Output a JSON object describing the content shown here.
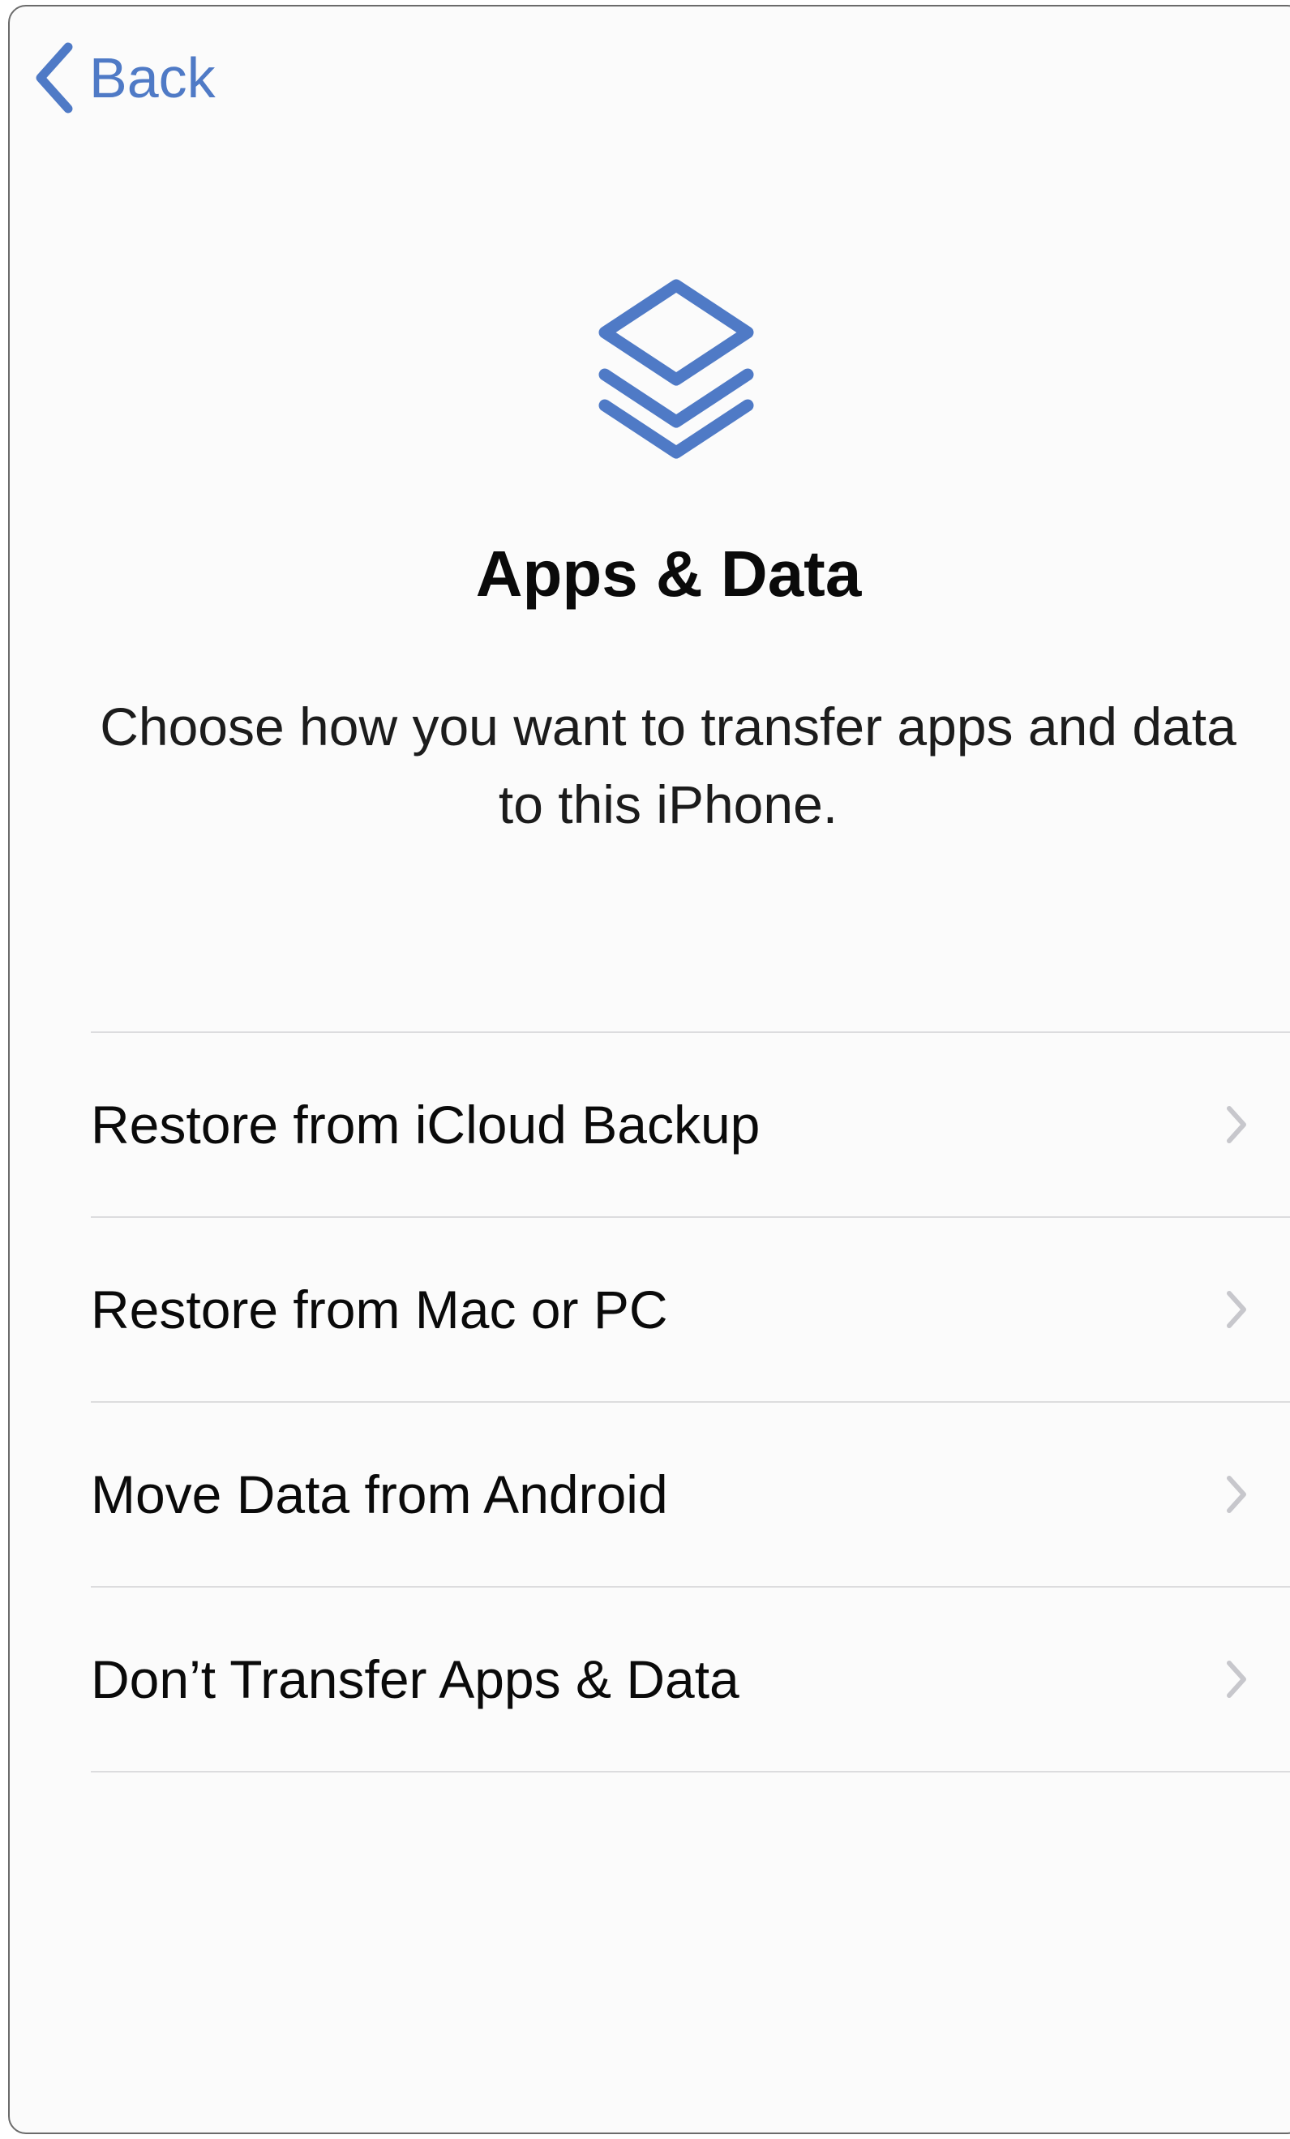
{
  "nav": {
    "back_label": "Back",
    "back_icon": "chevron-left-icon"
  },
  "hero": {
    "icon": "stacked-layers-icon",
    "title": "Apps & Data",
    "subtitle": "Choose how you want to transfer apps and data to this iPhone."
  },
  "options": [
    {
      "label": "Restore from iCloud Backup",
      "icon": "chevron-right-icon"
    },
    {
      "label": "Restore from Mac or PC",
      "icon": "chevron-right-icon"
    },
    {
      "label": "Move Data from Android",
      "icon": "chevron-right-icon"
    },
    {
      "label": "Don’t Transfer Apps & Data",
      "icon": "chevron-right-icon"
    }
  ],
  "colors": {
    "accent": "#4f7ac6",
    "background": "#fbfbfb",
    "separator": "#dcdcde",
    "chevron": "#c7c7cc",
    "text": "#0a0a0a"
  }
}
